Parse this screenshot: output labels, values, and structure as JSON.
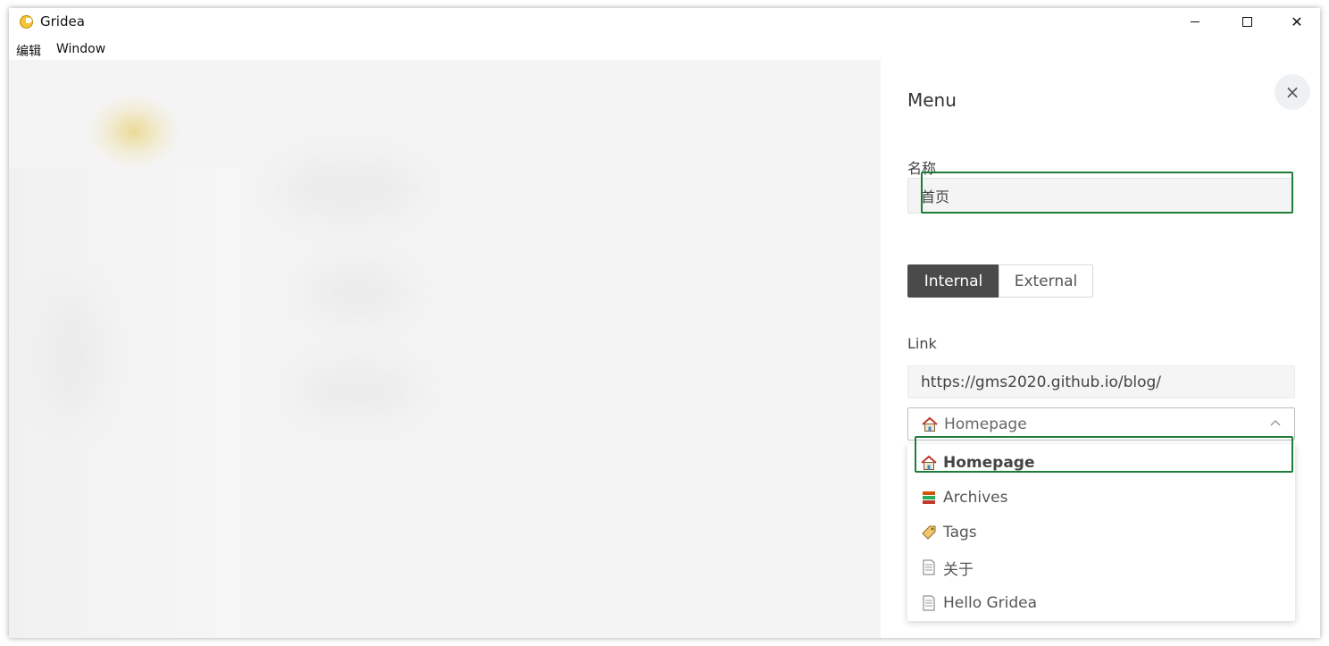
{
  "window": {
    "title": "Gridea",
    "controls": {
      "minimize": "minimize",
      "maximize": "maximize",
      "close": "✕"
    }
  },
  "menubar": {
    "items": [
      "编辑",
      "Window"
    ]
  },
  "panel": {
    "title": "Menu",
    "close_label": "×",
    "name_label": "名称",
    "name_value": "首页",
    "open_type": {
      "options": [
        "Internal",
        "External"
      ],
      "selected": "Internal"
    },
    "link_label": "Link",
    "link_value": "https://gms2020.github.io/blog/",
    "select": {
      "selected": "Homepage",
      "options": [
        {
          "label": "Homepage",
          "icon": "house-icon",
          "highlighted": true
        },
        {
          "label": "Archives",
          "icon": "books-icon"
        },
        {
          "label": "Tags",
          "icon": "tag-icon"
        },
        {
          "label": "关于",
          "icon": "page-icon"
        },
        {
          "label": "Hello Gridea",
          "icon": "page-icon"
        }
      ]
    }
  },
  "colors": {
    "accent_dark": "#4a4a4a",
    "highlight_green": "#1e7d3a"
  }
}
